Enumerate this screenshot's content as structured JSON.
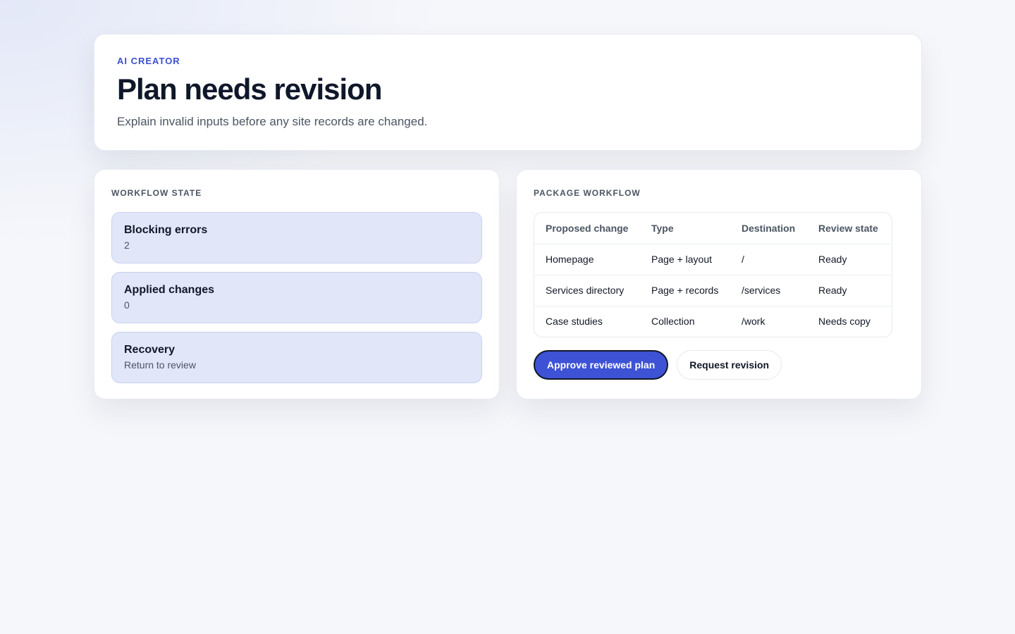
{
  "header": {
    "eyebrow": "AI CREATOR",
    "title": "Plan needs revision",
    "subtitle": "Explain invalid inputs before any site records are changed."
  },
  "workflow_state": {
    "title": "WORKFLOW STATE",
    "items": [
      {
        "label": "Blocking errors",
        "value": "2"
      },
      {
        "label": "Applied changes",
        "value": "0"
      },
      {
        "label": "Recovery",
        "value": "Return to review"
      }
    ]
  },
  "package_workflow": {
    "title": "PACKAGE WORKFLOW",
    "columns": [
      "Proposed change",
      "Type",
      "Destination",
      "Review state"
    ],
    "rows": [
      [
        "Homepage",
        "Page + layout",
        "/",
        "Ready"
      ],
      [
        "Services directory",
        "Page + records",
        "/services",
        "Ready"
      ],
      [
        "Case studies",
        "Collection",
        "/work",
        "Needs copy"
      ]
    ],
    "approve_label": "Approve reviewed plan",
    "revision_label": "Request revision"
  },
  "colors": {
    "accent": "#3d52d5",
    "state_card_bg": "#e1e6f8"
  }
}
